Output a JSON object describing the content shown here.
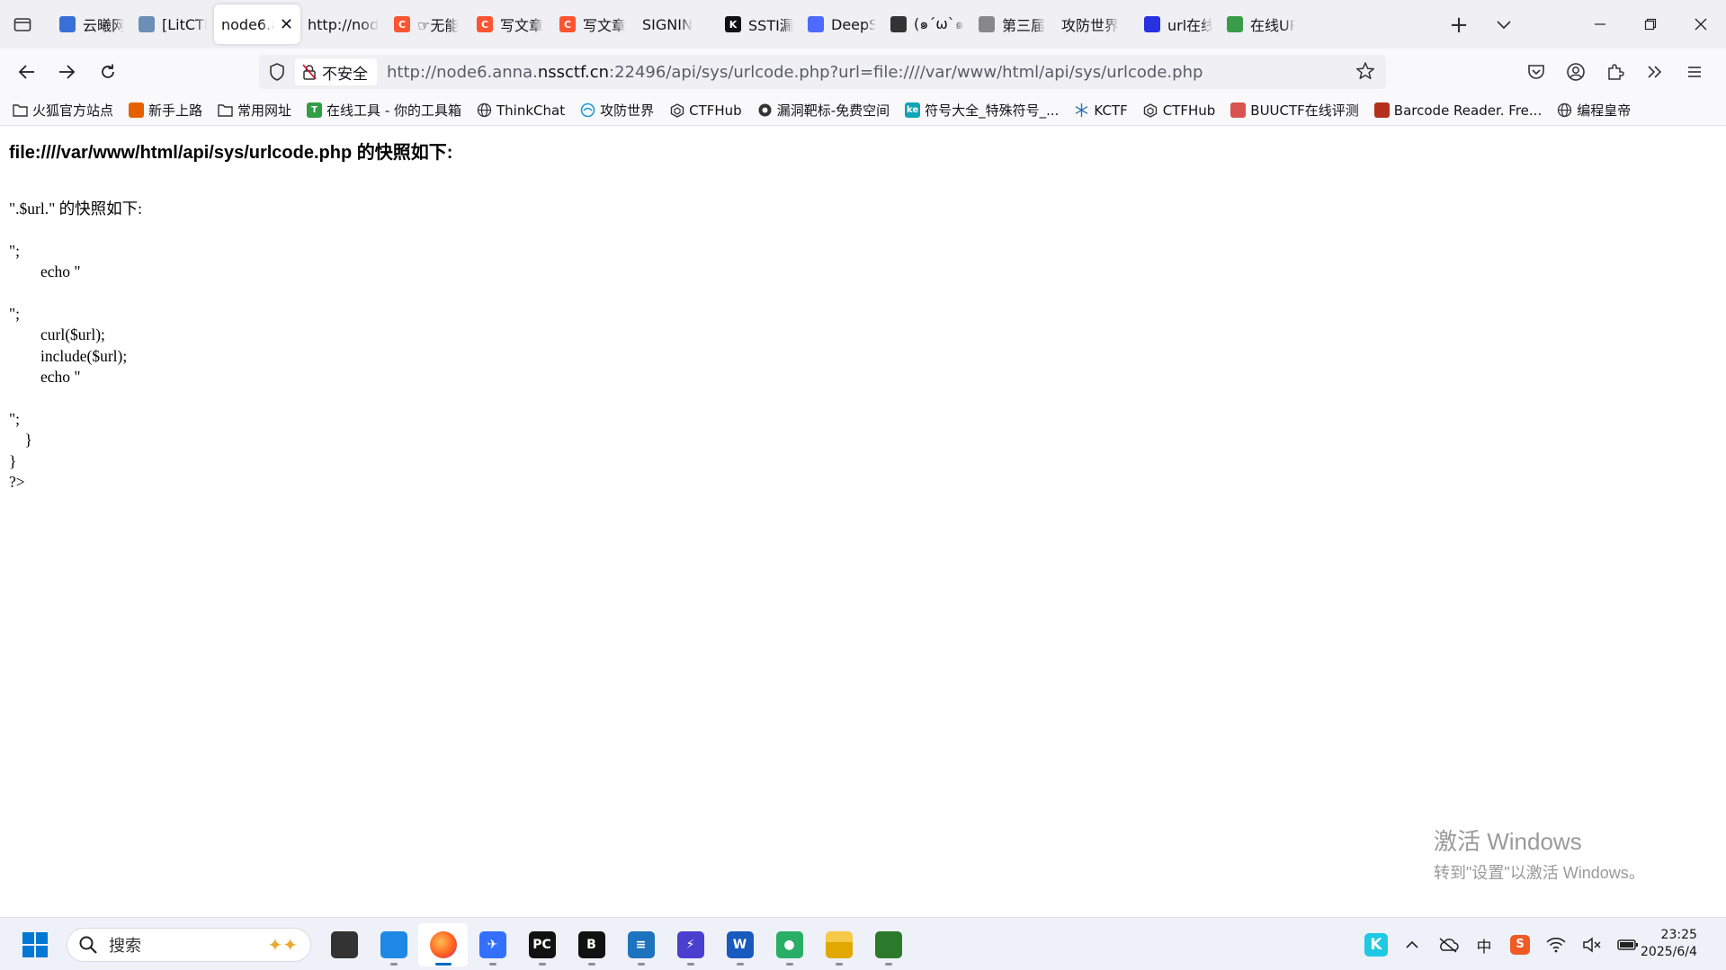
{
  "browser": {
    "tabs": [
      {
        "label": "云曦网",
        "icon": "yunxi-favicon",
        "color": "#3a6fd8"
      },
      {
        "label": "[LitCTF",
        "icon": "litctf-favicon",
        "color": "#6b8fb5"
      },
      {
        "label": "node6.a",
        "icon": "",
        "color": "",
        "active": true,
        "close": "✕"
      },
      {
        "label": "http://nod",
        "icon": "",
        "color": ""
      },
      {
        "label": "☞无能",
        "icon": "csdn-favicon",
        "color": "#fc5531",
        "glyph": "C"
      },
      {
        "label": "写文章",
        "icon": "csdn-favicon",
        "color": "#fc5531",
        "glyph": "C"
      },
      {
        "label": "写文章",
        "icon": "csdn-favicon",
        "color": "#fc5531",
        "glyph": "C"
      },
      {
        "label": "SIGNIN",
        "icon": "",
        "color": ""
      },
      {
        "label": "SSTI漏",
        "icon": "k-favicon",
        "color": "#111111",
        "glyph": "K"
      },
      {
        "label": "DeepS",
        "icon": "deepseek-favicon",
        "color": "#4d6bfe"
      },
      {
        "label": "(๑´ω`๑",
        "icon": "avatar-favicon",
        "color": "#333333"
      },
      {
        "label": "第三届",
        "icon": "mic-favicon",
        "color": "#888888"
      },
      {
        "label": "攻防世界",
        "icon": "",
        "color": ""
      },
      {
        "label": "url在线",
        "icon": "baidu-favicon",
        "color": "#2932e1"
      },
      {
        "label": "在线UR",
        "icon": "green-favicon",
        "color": "#3a9b4a"
      }
    ],
    "new_tab": "+",
    "insecure_label": "不安全",
    "url": {
      "prefix": "http://node6.anna.",
      "host": "nssctf.cn",
      "rest": ":22496/api/sys/urlcode.php?url=file:////var/www/html/api/sys/urlcode.php"
    },
    "bookmarks": [
      {
        "label": "火狐官方站点",
        "icon": "folder-icon"
      },
      {
        "label": "新手上路",
        "icon": "firefox-icon",
        "color": "#e66000"
      },
      {
        "label": "常用网址",
        "icon": "folder-icon"
      },
      {
        "label": "在线工具 - 你的工具箱",
        "icon": "tool-icon",
        "color": "#2f9e44",
        "glyph": "T"
      },
      {
        "label": "ThinkChat",
        "icon": "globe-icon"
      },
      {
        "label": "攻防世界",
        "icon": "adworld-icon",
        "color": "#1c9bd6"
      },
      {
        "label": "CTFHub",
        "icon": "ctfhub-icon"
      },
      {
        "label": "漏洞靶标-免费空间",
        "icon": "vuln-icon"
      },
      {
        "label": "符号大全_特殊符号_...",
        "icon": "ke-icon",
        "color": "#12a5b5",
        "glyph": "ke"
      },
      {
        "label": "KCTF",
        "icon": "snow-icon"
      },
      {
        "label": "CTFHub",
        "icon": "ctfhub-icon"
      },
      {
        "label": "BUUCTF在线评测",
        "icon": "buu-icon",
        "color": "#d9534f"
      },
      {
        "label": "Barcode Reader. Fre...",
        "icon": "barcode-icon",
        "color": "#b5311d"
      },
      {
        "label": "编程皇帝",
        "icon": "globe-icon"
      }
    ]
  },
  "page": {
    "heading": "file:////var/www/html/api/sys/urlcode.php 的快照如下:",
    "code": "\".$url.\" 的快照如下:\n\n\";\n        echo \"\n\n\";\n        curl($url);\n        include($url);\n        echo \"\n\n\";\n    }\n}\n?>"
  },
  "watermark": {
    "line1": "激活 Windows",
    "line2": "转到\"设置\"以激活 Windows。"
  },
  "taskbar": {
    "search_placeholder": "搜索",
    "apps": [
      {
        "name": "task-view",
        "color": "#333333",
        "glyph": ""
      },
      {
        "name": "remote-desktop",
        "color": "#1f88e5",
        "glyph": ""
      },
      {
        "name": "firefox",
        "color": "#ff5a1f",
        "glyph": "",
        "active": true
      },
      {
        "name": "feishu",
        "color": "#3370ff",
        "glyph": "✈"
      },
      {
        "name": "pycharm",
        "color": "#111111",
        "glyph": "PC"
      },
      {
        "name": "burpsuite",
        "color": "#111111",
        "glyph": "B"
      },
      {
        "name": "notepad",
        "color": "#1e73be",
        "glyph": "≡"
      },
      {
        "name": "vscode-like",
        "color": "#4b3fcf",
        "glyph": "⚡"
      },
      {
        "name": "word",
        "color": "#185abd",
        "glyph": "W"
      },
      {
        "name": "wechat",
        "color": "#2aae67",
        "glyph": "●"
      },
      {
        "name": "file-explorer",
        "color": "#f5b700",
        "glyph": ""
      },
      {
        "name": "network-tool",
        "color": "#2b7a2b",
        "glyph": ""
      }
    ],
    "tray": {
      "ime": "中",
      "time": "23:25",
      "date": "2025/6/4"
    }
  }
}
